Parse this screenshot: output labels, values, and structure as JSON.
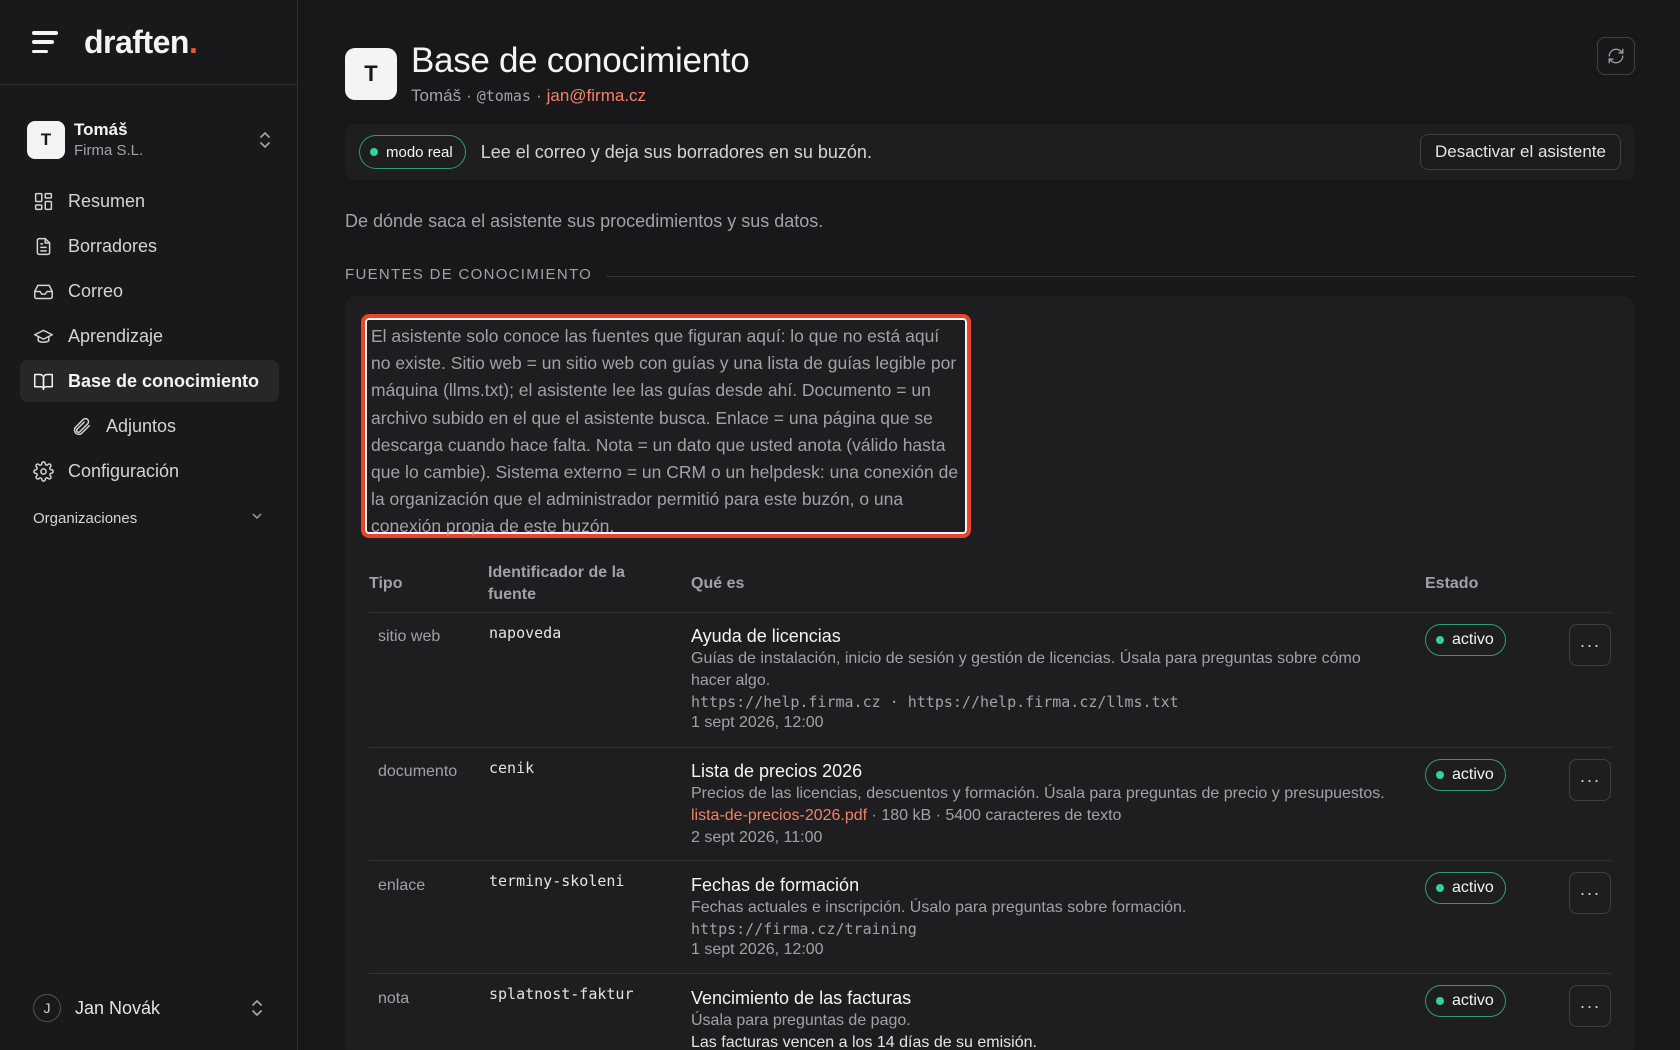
{
  "brand": {
    "name": "draften",
    "dot": "."
  },
  "org": {
    "initial": "T",
    "name": "Tomáš",
    "company": "Firma S.L."
  },
  "nav": [
    {
      "label": "Resumen",
      "icon": "grid-icon"
    },
    {
      "label": "Borradores",
      "icon": "document-icon"
    },
    {
      "label": "Correo",
      "icon": "inbox-icon"
    },
    {
      "label": "Aprendizaje",
      "icon": "graduation-cap-icon"
    },
    {
      "label": "Base de conocimiento",
      "icon": "book-icon",
      "active": true
    },
    {
      "label": "Adjuntos",
      "icon": "paperclip-icon",
      "sub": true
    },
    {
      "label": "Configuración",
      "icon": "gear-icon"
    }
  ],
  "orgs_section": "Organizaciones",
  "user": {
    "initial": "J",
    "name": "Jan Novák"
  },
  "header": {
    "initial": "T",
    "title": "Base de conocimiento",
    "name": "Tomáš",
    "separator": "·",
    "handle": "@tomas",
    "email": "jan@firma.cz"
  },
  "mode": {
    "badge": "modo real",
    "text": "Lee el correo y deja sus borradores en su buzón.",
    "button": "Desactivar el asistente"
  },
  "intro": "De dónde saca el asistente sus procedimientos y sus datos.",
  "section_title": "FUENTES DE CONOCIMIENTO",
  "notice": "El asistente solo conoce las fuentes que figuran aquí: lo que no está aquí no existe. Sitio web = un sitio web con guías y una lista de guías legible por máquina (llms.txt); el asistente lee las guías desde ahí. Documento = un archivo subido en el que el asistente busca. Enlace = una página que se descarga cuando hace falta. Nota = un dato que usted anota (válido hasta que lo cambie). Sistema externo = un CRM o un helpdesk: una conexión de la organización que el administrador permitió para este buzón, o una conexión propia de este buzón.",
  "table": {
    "headers": {
      "type": "Tipo",
      "id": "Identificador de la fuente",
      "what": "Qué es",
      "state": "Estado"
    },
    "rows": [
      {
        "type": "sitio web",
        "id": "napoveda",
        "title": "Ayuda de licencias",
        "desc": "Guías de instalación, inicio de sesión y gestión de licencias. Úsala para preguntas sobre cómo hacer algo.",
        "url": "https://help.firma.cz · https://help.firma.cz/llms.txt",
        "date": "1 sept 2026, 12:00",
        "state": "activo",
        "more": "···"
      },
      {
        "type": "documento",
        "id": "cenik",
        "title": "Lista de precios 2026",
        "desc": "Precios de las licencias, descuentos y formación. Úsala para preguntas de precio y presupuestos.",
        "file": "lista-de-precios-2026.pdf",
        "file_meta": " · 180 kB · 5400 caracteres de texto",
        "date": "2 sept 2026, 11:00",
        "state": "activo",
        "more": "···"
      },
      {
        "type": "enlace",
        "id": "terminy-skoleni",
        "title": "Fechas de formación",
        "desc": "Fechas actuales e inscripción. Úsalo para preguntas sobre formación.",
        "url": "https://firma.cz/training",
        "date": "1 sept 2026, 12:00",
        "state": "activo",
        "more": "···"
      },
      {
        "type": "nota",
        "id": "splatnost-faktur",
        "title": "Vencimiento de las facturas",
        "desc": "Úsala para preguntas de pago.",
        "note": "Las facturas vencen a los 14 días de su emisión.",
        "state": "activo",
        "more": "···"
      }
    ]
  }
}
